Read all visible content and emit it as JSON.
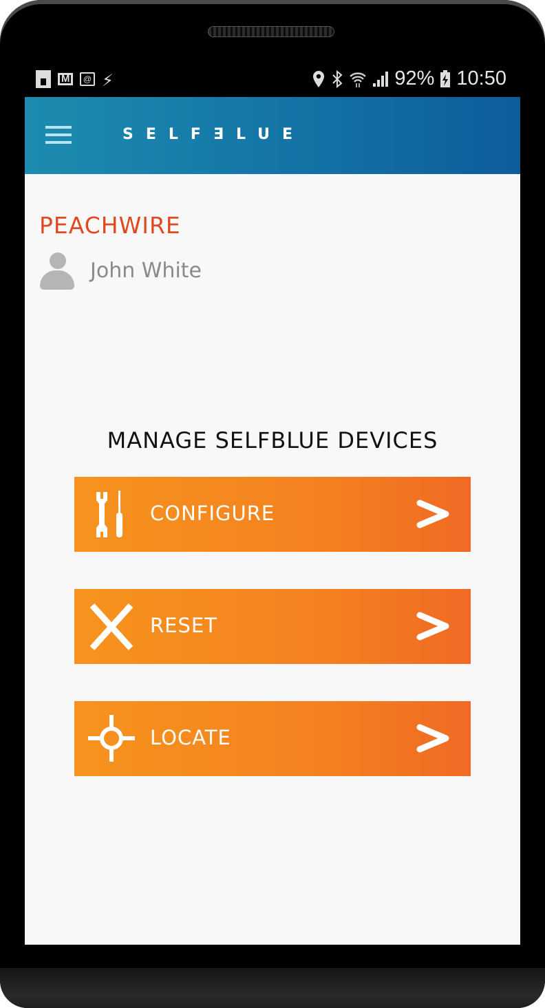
{
  "status_bar": {
    "left_icons": [
      "sim-card-icon",
      "gmail-icon",
      "email-icon",
      "charging-bolt-icon"
    ],
    "right_icons": [
      "location-pin-icon",
      "bluetooth-icon",
      "wifi-icon",
      "cell-signal-icon",
      "battery-charging-icon"
    ],
    "battery_percent": "92%",
    "time": "10:50"
  },
  "app_bar": {
    "menu_icon": "hamburger-menu-icon",
    "brand": "SELFƎLUE"
  },
  "account": {
    "organization": "PEACHWIRE",
    "user_name": "John White",
    "avatar_icon": "user-avatar-icon"
  },
  "main": {
    "section_title": "MANAGE SELFBLUE DEVICES",
    "actions": [
      {
        "label": "CONFIGURE",
        "icon": "wrench-screwdriver-icon",
        "chevron": "chevron-right-icon"
      },
      {
        "label": "RESET",
        "icon": "x-cross-icon",
        "chevron": "chevron-right-icon"
      },
      {
        "label": "LOCATE",
        "icon": "crosshair-target-icon",
        "chevron": "chevron-right-icon"
      }
    ]
  },
  "colors": {
    "app_bar_start": "#1d8cb0",
    "app_bar_end": "#0e5d9b",
    "organization": "#e0491f",
    "button_start": "#f6931e",
    "button_end": "#f06a24",
    "background": "#f8f8f8"
  }
}
